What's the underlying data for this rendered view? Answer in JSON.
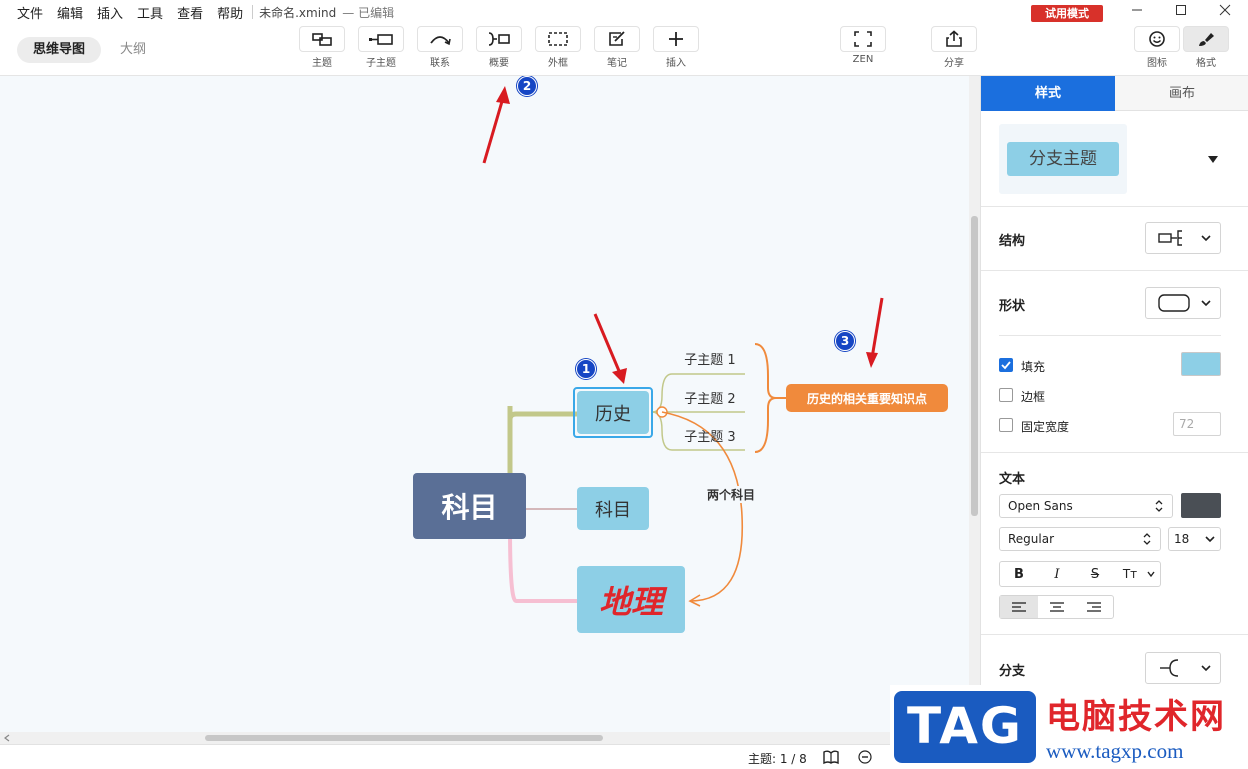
{
  "menu": [
    "文件",
    "编辑",
    "插入",
    "工具",
    "查看",
    "帮助"
  ],
  "window": {
    "file_name": "未命名.xmind",
    "status": "— 已编辑",
    "trial": "试用模式"
  },
  "view_tabs": {
    "mindmap": "思维导图",
    "outline": "大纲"
  },
  "tools": {
    "topic": "主题",
    "subtopic": "子主题",
    "relation": "联系",
    "summary": "概要",
    "boundary": "外框",
    "note": "笔记",
    "insert": "插入",
    "zen": "ZEN",
    "share": "分享",
    "icon": "图标",
    "format": "格式"
  },
  "mindmap": {
    "central": "科目",
    "branches": [
      "历史",
      "科目",
      "地理"
    ],
    "subtopics": [
      "子主题 1",
      "子主题 2",
      "子主题 3"
    ],
    "summary": "历史的相关重要知识点",
    "relation_label": "两个科目",
    "badges": [
      "1",
      "2",
      "3"
    ]
  },
  "status": {
    "topics": "主题: 1 / 8"
  },
  "panel": {
    "tabs": {
      "style": "样式",
      "canvas": "画布"
    },
    "preview": "分支主题",
    "structure": "结构",
    "shape": "形状",
    "fill": "填充",
    "border": "边框",
    "fixed_width": "固定宽度",
    "fixed_width_value": "72",
    "text": "文本",
    "font": "Open Sans",
    "weight": "Regular",
    "size": "18",
    "branch": "分支",
    "format_buttons": [
      "B",
      "I",
      "S",
      "Tт"
    ]
  },
  "colors": {
    "accent": "#1b6fde",
    "central": "#5a6f96",
    "branch_fill": "#8dcfe6",
    "summary": "#f08a3c",
    "arrow": "#d81b21",
    "badge": "#1646c4",
    "text_swatch": "#4a4f55"
  },
  "watermark": {
    "brand": "TAG",
    "site_name": "电脑技术网",
    "url": "www.tagxp.com"
  }
}
